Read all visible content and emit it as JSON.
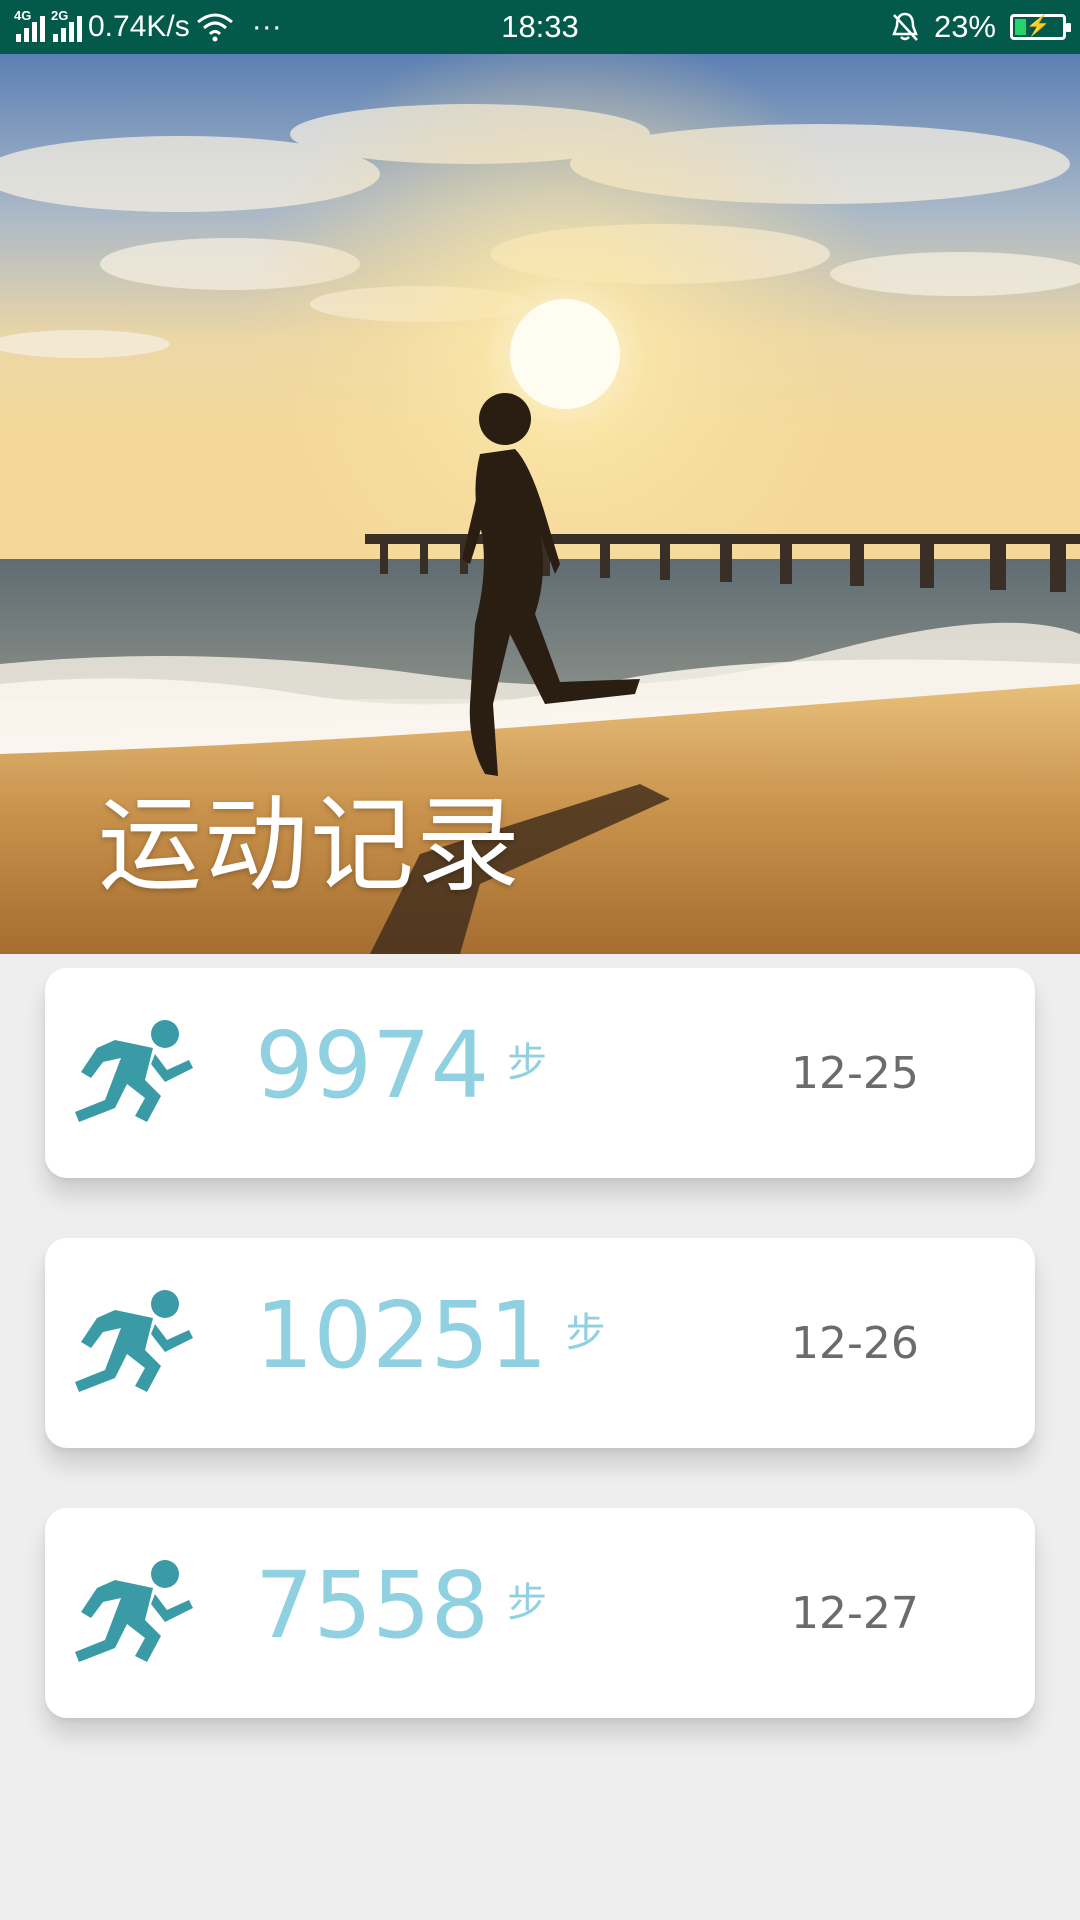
{
  "status_bar": {
    "net1": "4G",
    "net2": "2G",
    "speed": "0.74K/s",
    "more": "···",
    "time": "18:33",
    "battery": "23%",
    "battery_level": 0.23
  },
  "hero": {
    "title": "运动记录"
  },
  "records": [
    {
      "steps": "9974",
      "unit": "步",
      "date": "12-25"
    },
    {
      "steps": "10251",
      "unit": "步",
      "date": "12-26"
    },
    {
      "steps": "7558",
      "unit": "步",
      "date": "12-27"
    }
  ],
  "colors": {
    "status_bar": "#03594a",
    "steps": "#8fd1e0",
    "icon": "#3a9ba6",
    "date": "#6b6b6b",
    "background": "#eeeeee"
  },
  "icons": {
    "record": "running-man-icon"
  }
}
